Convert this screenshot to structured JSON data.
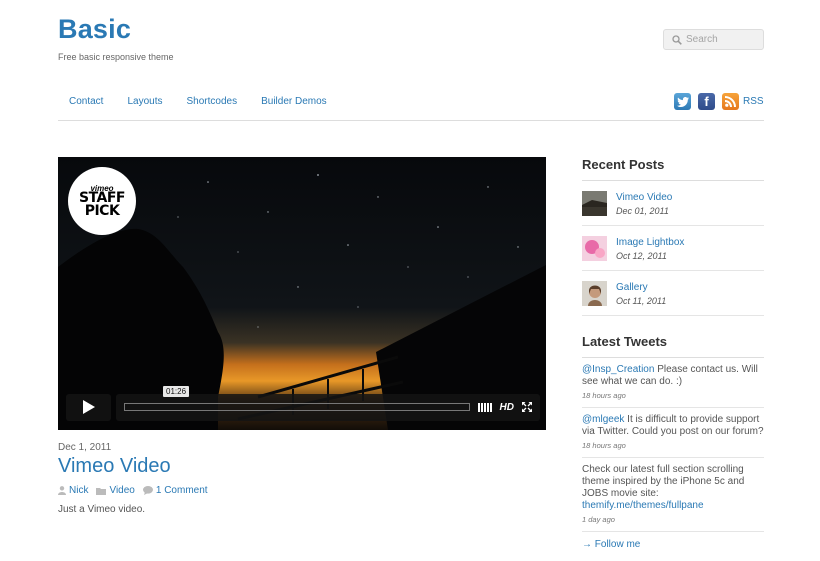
{
  "header": {
    "site_title": "Basic",
    "tagline": "Free basic responsive theme",
    "search_placeholder": "Search"
  },
  "nav": {
    "items": [
      "Contact",
      "Layouts",
      "Shortcodes",
      "Builder Demos"
    ]
  },
  "social": {
    "icons": [
      "twitter-icon",
      "facebook-icon",
      "rss-icon"
    ],
    "rss_label": "RSS"
  },
  "post": {
    "video": {
      "badge_top": "vimeo",
      "badge_line1": "STAFF",
      "badge_line2": "PICK",
      "time": "01:26",
      "hd_label": "HD"
    },
    "date": "Dec 1, 2011",
    "title": "Vimeo Video",
    "author": "Nick",
    "category": "Video",
    "comments": "1 Comment",
    "excerpt": "Just a Vimeo video."
  },
  "sidebar": {
    "recent_posts_title": "Recent Posts",
    "recent_posts": [
      {
        "title": "Vimeo Video",
        "date": "Dec 01, 2011"
      },
      {
        "title": "Image Lightbox",
        "date": "Oct 12, 2011"
      },
      {
        "title": "Gallery",
        "date": "Oct 11, 2011"
      }
    ],
    "latest_tweets_title": "Latest Tweets",
    "tweets": [
      {
        "handle": "@Insp_Creation",
        "text": " Please contact us. Will see what we can do. :)",
        "ago": "18 hours ago"
      },
      {
        "handle": "@mlgeek",
        "text": " It is difficult to provide support via Twitter. Could you post on our forum?",
        "ago": "18 hours ago"
      },
      {
        "handle": "",
        "text": "Check our latest full section scrolling theme inspired by the iPhone 5c and JOBS movie site: ",
        "link": "themify.me/themes/fullpane",
        "ago": "1 day ago"
      }
    ],
    "follow_label": "→ Follow me"
  },
  "colors": {
    "accent": "#2a79b4"
  }
}
